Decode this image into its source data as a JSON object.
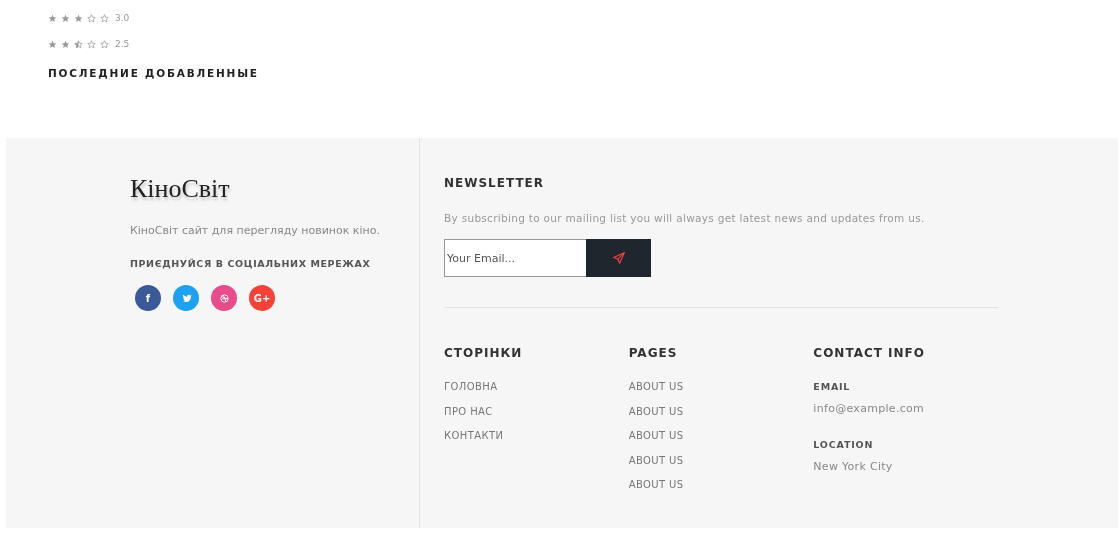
{
  "ratings": [
    {
      "stars": 3,
      "reading": "3.0"
    },
    {
      "stars": 2.5,
      "reading": "2.5"
    }
  ],
  "recent_heading": "ПОСЛЕДНИЕ ДОБАВЛЕННЫЕ",
  "footer": {
    "brand": {
      "logo": "КіноСвіт",
      "description": "КіноСвіт сайт для перегляду новинок кіно.",
      "social_heading": "ПРИЄДНУЙСЯ В СОЦІАЛЬНИХ МЕРЕЖАХ",
      "social": [
        {
          "kind": "facebook",
          "glyph": "f",
          "color": "#3b5998"
        },
        {
          "kind": "twitter",
          "color": "#1da1f2"
        },
        {
          "kind": "dribbble",
          "color": "#ea4c89"
        },
        {
          "kind": "google",
          "glyph": "G+",
          "color": "#f44336"
        }
      ]
    },
    "newsletter": {
      "heading": "NEWSLETTER",
      "text": "By subscribing to our mailing list you will always get latest news and updates from us.",
      "placeholder": "Your Email..."
    },
    "columns": [
      {
        "heading": "СТОРІНКИ",
        "kind": "links",
        "items": [
          "ГОЛОВНА",
          "ПРО НАС",
          "КОНТАКТИ"
        ]
      },
      {
        "heading": "PAGES",
        "kind": "links",
        "items": [
          "ABOUT US",
          "ABOUT US",
          "ABOUT US",
          "ABOUT US",
          "ABOUT US"
        ]
      },
      {
        "heading": "CONTACT INFO",
        "kind": "contact",
        "items": [
          {
            "label": "EMAIL",
            "value": "info@example.com"
          },
          {
            "label": "LOCATION",
            "value": "New York City"
          }
        ]
      }
    ]
  }
}
